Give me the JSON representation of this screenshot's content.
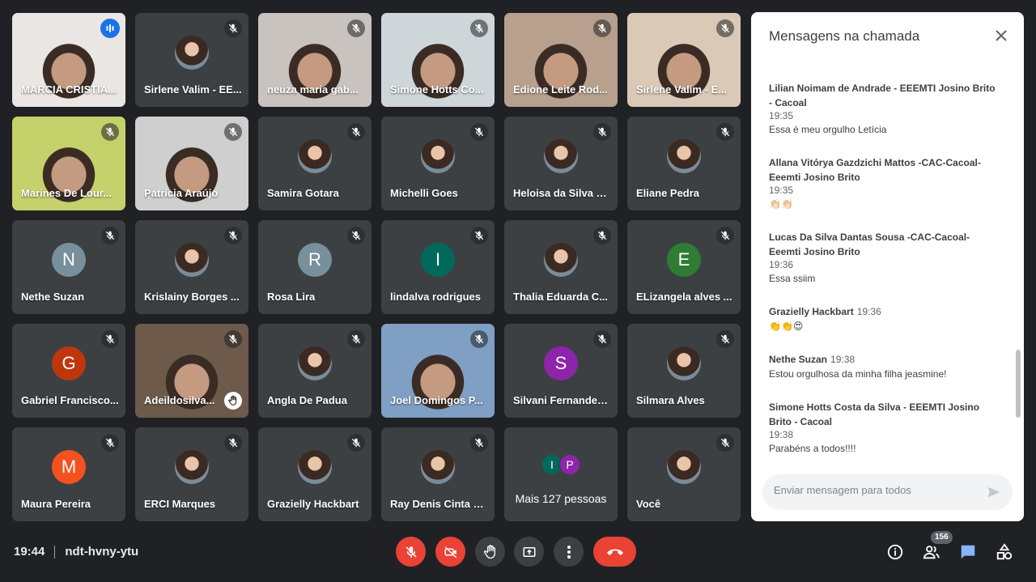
{
  "participants": [
    {
      "name": "MARCIA CRISTIA...",
      "kind": "video",
      "speaking": true,
      "bg": "#e9e6e4"
    },
    {
      "name": "Sirlene Valim - EE...",
      "kind": "photo",
      "muted": true
    },
    {
      "name": "neuza maria gab...",
      "kind": "video",
      "muted": true,
      "bg": "#c9c3c0"
    },
    {
      "name": "Simone Hotts Co...",
      "kind": "video",
      "muted": true,
      "bg": "#cfd6da"
    },
    {
      "name": "Edione Leite Rod...",
      "kind": "video",
      "muted": true,
      "bg": "#b7a08d"
    },
    {
      "name": "Sirlene Valim - E...",
      "kind": "video",
      "muted": true,
      "bg": "#d9c9b6"
    },
    {
      "name": "Marines De Lour...",
      "kind": "video",
      "muted": true,
      "bg": "#c5d16a"
    },
    {
      "name": "Patrícia Araújo",
      "kind": "video",
      "muted": true,
      "bg": "#cfcfcf"
    },
    {
      "name": "Samira Gotara",
      "kind": "photo",
      "muted": true
    },
    {
      "name": "Michelli Goes",
      "kind": "photo",
      "muted": true
    },
    {
      "name": "Heloisa da Silva S...",
      "kind": "photo",
      "muted": true
    },
    {
      "name": "Eliane Pedra",
      "kind": "photo",
      "muted": true
    },
    {
      "name": "Nethe Suzan",
      "kind": "initial",
      "initial": "N",
      "color": "#78909c",
      "muted": true
    },
    {
      "name": "Krislainy Borges ...",
      "kind": "photo",
      "muted": true
    },
    {
      "name": "Rosa Lira",
      "kind": "initial",
      "initial": "R",
      "color": "#78909c",
      "muted": true
    },
    {
      "name": "lindalva rodrigues",
      "kind": "initial",
      "initial": "I",
      "color": "#00695c",
      "muted": true
    },
    {
      "name": "Thalia Eduarda C...",
      "kind": "photo",
      "muted": true
    },
    {
      "name": "ELizangela alves ...",
      "kind": "initial",
      "initial": "E",
      "color": "#2e7d32",
      "muted": true
    },
    {
      "name": "Gabriel Francisco...",
      "kind": "initial",
      "initial": "G",
      "color": "#bf360c",
      "muted": true
    },
    {
      "name": "Adeildosilva...",
      "kind": "video",
      "muted": true,
      "hand": true,
      "bg": "#6d5a4a"
    },
    {
      "name": "Angla De Padua",
      "kind": "photo",
      "muted": true
    },
    {
      "name": "Joel Domingos P...",
      "kind": "video",
      "muted": true,
      "bg": "#7f9fc4"
    },
    {
      "name": "Silvani Fernandes...",
      "kind": "initial",
      "initial": "S",
      "color": "#8e24aa",
      "muted": true
    },
    {
      "name": "Silmara Alves",
      "kind": "photo",
      "muted": true
    },
    {
      "name": "Maura Pereira",
      "kind": "initial",
      "initial": "M",
      "color": "#f4511e",
      "muted": true
    },
    {
      "name": "ERCI Marques",
      "kind": "photo",
      "muted": true
    },
    {
      "name": "Grazielly Hackbart",
      "kind": "photo",
      "muted": true
    },
    {
      "name": "Ray Denis Cinta L...",
      "kind": "photo",
      "muted": true
    },
    {
      "name": "",
      "kind": "more"
    },
    {
      "name": "Você",
      "kind": "photo",
      "muted": true
    }
  ],
  "more_tile": {
    "label": "Mais 127 pessoas",
    "initials": [
      "I",
      "P"
    ],
    "colors": [
      "#00695c",
      "#8e24aa"
    ]
  },
  "chat": {
    "title": "Mensagens na chamada",
    "messages": [
      {
        "sender": "Lilian Noimam de Andrade - EEEMTI Josino Brito - Cacoal",
        "time": "19:35",
        "text": "Essa é meu orgulho Letícia"
      },
      {
        "sender": "Allana Vitórya Gazdzichi Mattos -CAC-Cacoal-Eeemti Josino Brito",
        "time": "19:35",
        "text": "👏🏻👏🏻"
      },
      {
        "sender": "Lucas Da Silva Dantas Sousa -CAC-Cacoal-Eeemti Josino Brito",
        "time": "19:36",
        "text": "Essa ssiim"
      },
      {
        "sender": "Grazielly Hackbart",
        "time": "19:36",
        "inline": true,
        "text": "👏👏😍"
      },
      {
        "sender": "Nethe Suzan",
        "time": "19:38",
        "inline": true,
        "text": "Estou orgulhosa da minha filha jeasmine!"
      },
      {
        "sender": "Simone Hotts Costa da Silva - EEEMTI Josino Brito - Cacoal",
        "time": "19:38",
        "text": "Parabéns a todos!!!!"
      }
    ],
    "input_placeholder": "Enviar mensagem para todos"
  },
  "bottom": {
    "time": "19:44",
    "meeting_code": "ndt-hvny-ytu",
    "participant_count": "156"
  }
}
